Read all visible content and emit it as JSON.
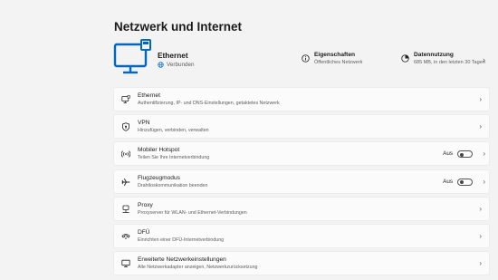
{
  "page": {
    "title": "Netzwerk und Internet"
  },
  "hero": {
    "name": "Ethernet",
    "status": "Verbunden",
    "properties": {
      "title": "Eigenschaften",
      "subtitle": "Öffentliches Netzwerk"
    },
    "data_usage": {
      "title": "Datennutzung",
      "subtitle": "685 MB, in den letzten 30 Tagen"
    }
  },
  "items": [
    {
      "title": "Ethernet",
      "subtitle": "Authentifizierung, IP- und DNS-Einstellungen, getaktetes Netzwerk",
      "icon": "ethernet-icon"
    },
    {
      "title": "VPN",
      "subtitle": "Hinzufügen, verbinden, verwalten",
      "icon": "shield-icon"
    },
    {
      "title": "Mobiler Hotspot",
      "subtitle": "Teilen Sie Ihre Internetverbindung",
      "icon": "hotspot-icon",
      "toggle_label": "Aus",
      "toggle_on": false
    },
    {
      "title": "Flugzeugmodus",
      "subtitle": "Drahtloskommunikation beenden",
      "icon": "airplane-icon",
      "toggle_label": "Aus",
      "toggle_on": false
    },
    {
      "title": "Proxy",
      "subtitle": "Proxyserver für WLAN- und Ethernet-Verbindungen",
      "icon": "proxy-icon"
    },
    {
      "title": "DFÜ",
      "subtitle": "Einrichten einer DFÜ-Internetverbindung",
      "icon": "dialup-icon"
    },
    {
      "title": "Erweiterte Netzwerkeinstellungen",
      "subtitle": "Alle Netzwerkadapter anzeigen, Netzwerkzurücksetzung",
      "icon": "monitor-icon"
    }
  ],
  "colors": {
    "accent": "#0067c0",
    "background": "#f3f3f3",
    "card": "#fbfbfb"
  }
}
